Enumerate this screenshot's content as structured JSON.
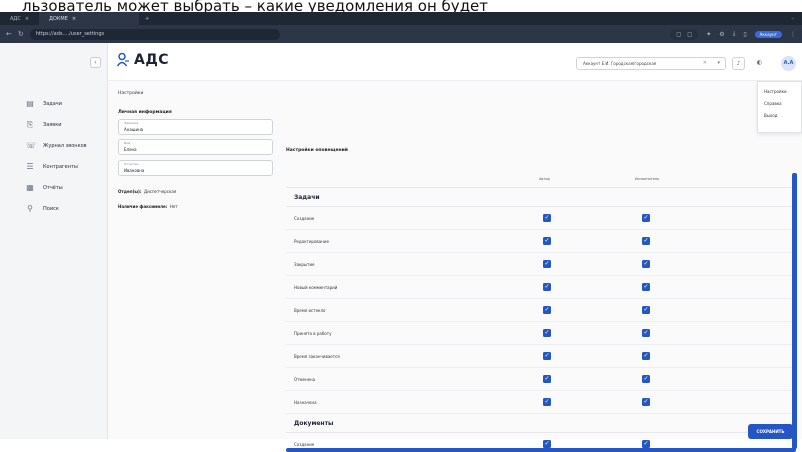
{
  "caption": "льзователь может выбрать – какие уведомления он будет",
  "browser": {
    "tabs": [
      {
        "label": "АДС"
      },
      {
        "label": "ДОКМЕ"
      }
    ],
    "url": "https://ads.…/user_settings",
    "profile_pill": "Аккаунт"
  },
  "app": {
    "logo_text": "АДС",
    "sidebar": {
      "collapse_icon": "‹",
      "items": [
        {
          "icon": "tasks-icon",
          "label": "Задачи"
        },
        {
          "icon": "requests-icon",
          "label": "Заявки"
        },
        {
          "icon": "call-log-icon",
          "label": "Журнал звонков"
        },
        {
          "icon": "contracts-icon",
          "label": "Контрагенты"
        },
        {
          "icon": "reports-icon",
          "label": "Отчёты"
        },
        {
          "icon": "search-icon",
          "label": "Поиск"
        }
      ]
    },
    "header": {
      "org_select_value": "Аккаунт Е.И. Городская/городская",
      "avatar_initials": "А.А"
    },
    "user_menu": [
      "Настройки",
      "Справка",
      "Выход"
    ],
    "breadcrumb": "Настройки",
    "personal": {
      "title": "Личная информация",
      "fields": [
        {
          "label": "Фамилия",
          "value": "Анашина"
        },
        {
          "label": "Имя",
          "value": "Елена"
        },
        {
          "label": "Отчество",
          "value": "Ивановна"
        }
      ],
      "department_label": "Отдел(ы):",
      "department_value": "Диспетчерская",
      "signature_label": "Наличие факсимиле:",
      "signature_value": "Нет"
    },
    "notifications": {
      "title": "Настройки оповещений",
      "columns": [
        "Автор",
        "Исполнитель"
      ],
      "groups": [
        {
          "title": "Задачи",
          "rows": [
            {
              "label": "Создание",
              "author": true,
              "executor": true
            },
            {
              "label": "Редактирование",
              "author": true,
              "executor": true
            },
            {
              "label": "Закрытие",
              "author": true,
              "executor": true
            },
            {
              "label": "Новый комментарий",
              "author": true,
              "executor": true
            },
            {
              "label": "Время истекло",
              "author": true,
              "executor": true
            },
            {
              "label": "Принята в работу",
              "author": true,
              "executor": true
            },
            {
              "label": "Время заканчивается",
              "author": true,
              "executor": true
            },
            {
              "label": "Отменена",
              "author": true,
              "executor": true
            },
            {
              "label": "Назначена",
              "author": true,
              "executor": true
            }
          ]
        },
        {
          "title": "Документы",
          "rows": [
            {
              "label": "Создание",
              "author": true,
              "executor": true
            }
          ]
        }
      ]
    },
    "save_label": "СОХРАНИТЬ",
    "accent_color": "#2456c4"
  }
}
